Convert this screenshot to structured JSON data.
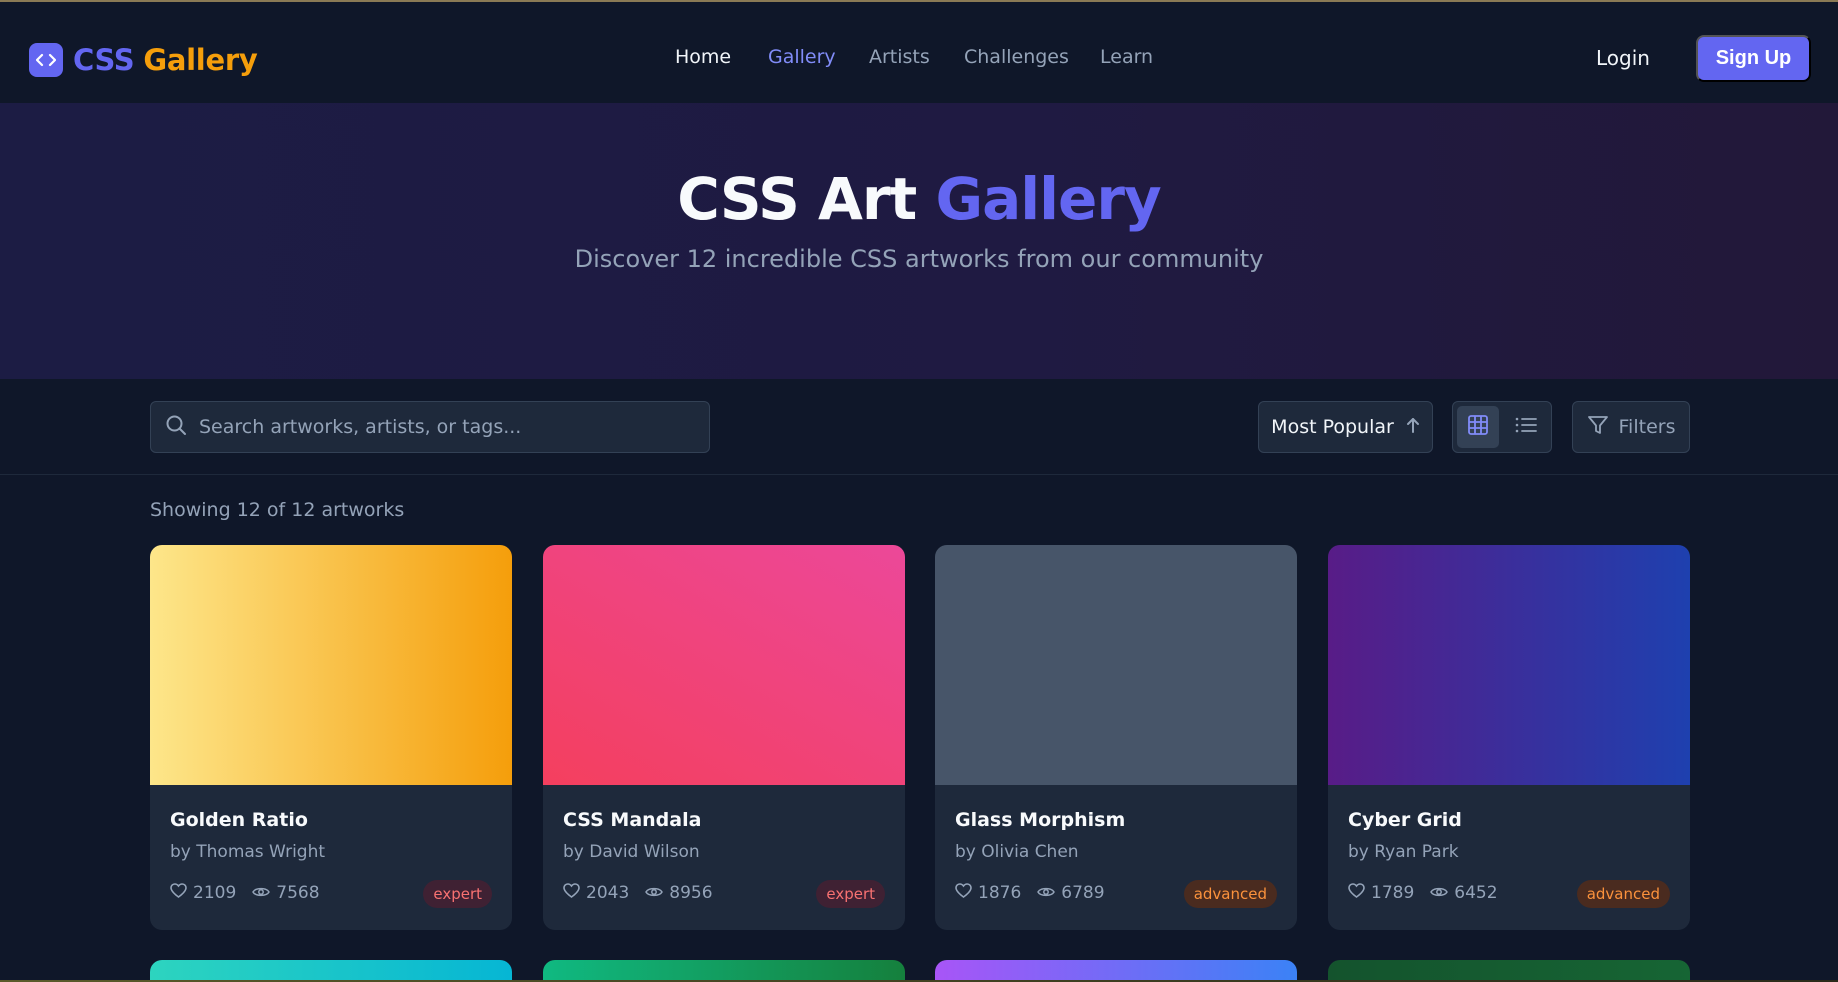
{
  "brand": {
    "name_a": "CSS",
    "name_b": "Gallery",
    "logo_icon": "code-brackets-icon"
  },
  "nav": {
    "links": [
      {
        "label": "Home",
        "state": "default"
      },
      {
        "label": "Gallery",
        "state": "active"
      },
      {
        "label": "Artists",
        "state": "default"
      },
      {
        "label": "Challenges",
        "state": "default"
      },
      {
        "label": "Learn",
        "state": "default"
      }
    ],
    "login_label": "Login",
    "signup_label": "Sign Up"
  },
  "hero": {
    "title_a": "CSS Art",
    "title_b": "Gallery",
    "subtitle": "Discover 12 incredible CSS artworks from our community"
  },
  "toolbar": {
    "search_placeholder": "Search artworks, artists, or tags...",
    "sort_label": "Most Popular",
    "view_mode": "grid",
    "filters_label": "Filters"
  },
  "results": {
    "count_text": "Showing 12 of 12 artworks"
  },
  "cards": [
    {
      "title": "Golden Ratio",
      "artist": "by Thomas Wright",
      "likes": "2109",
      "views": "7568",
      "level": "expert",
      "gradient": [
        "#fde68a",
        "#f59e0b"
      ],
      "angle": "90deg"
    },
    {
      "title": "CSS Mandala",
      "artist": "by David Wilson",
      "likes": "2043",
      "views": "8956",
      "level": "expert",
      "gradient": [
        "#f43f5e",
        "#ec4899"
      ],
      "angle": "30deg"
    },
    {
      "title": "Glass Morphism",
      "artist": "by Olivia Chen",
      "likes": "1876",
      "views": "6789",
      "level": "advanced",
      "gradient": [
        "#475569",
        "#475569"
      ],
      "angle": "90deg"
    },
    {
      "title": "Cyber Grid",
      "artist": "by Ryan Park",
      "likes": "1789",
      "views": "6452",
      "level": "advanced",
      "gradient": [
        "#581c87",
        "#1e40af"
      ],
      "angle": "90deg"
    }
  ],
  "next_row_gradients": [
    [
      "#2dd4bf",
      "#06b6d4"
    ],
    [
      "#10b981",
      "#15803d"
    ],
    [
      "#a855f7",
      "#3b82f6"
    ],
    [
      "#14532d",
      "#166534"
    ]
  ],
  "colors": {
    "accent": "#6366f1",
    "brand_secondary": "#f59e0b",
    "background": "#0f1729",
    "surface": "#1e293b"
  }
}
